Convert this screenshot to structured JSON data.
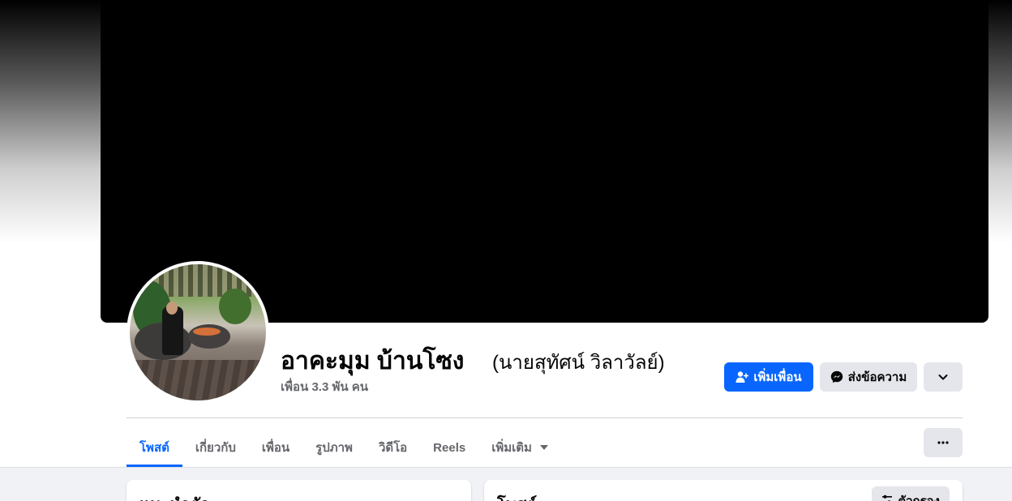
{
  "profile": {
    "name": "อาคะมุม บ้านโซง",
    "alternate_name": "(นายสุทัศน์ วิลาวัลย์)",
    "friend_count": "เพื่อน 3.3 พัน คน"
  },
  "actions": {
    "add_friend": "เพิ่มเพื่อน",
    "send_message": "ส่งข้อความ"
  },
  "tabs": [
    {
      "label": "โพสต์",
      "active": true
    },
    {
      "label": "เกี่ยวกับ",
      "active": false
    },
    {
      "label": "เพื่อน",
      "active": false
    },
    {
      "label": "รูปภาพ",
      "active": false
    },
    {
      "label": "วิดีโอ",
      "active": false
    },
    {
      "label": "Reels",
      "active": false
    },
    {
      "label": "เพิ่มเติม",
      "active": false
    }
  ],
  "cards": {
    "intro_title": "แนะนำตัว",
    "posts_title": "โพสต์",
    "filter_label": "ตัวกรอง"
  },
  "colors": {
    "primary": "#0866ff",
    "secondary_button": "#e4e6eb",
    "muted_text": "#65676b",
    "feed_background": "#f0f2f5"
  }
}
